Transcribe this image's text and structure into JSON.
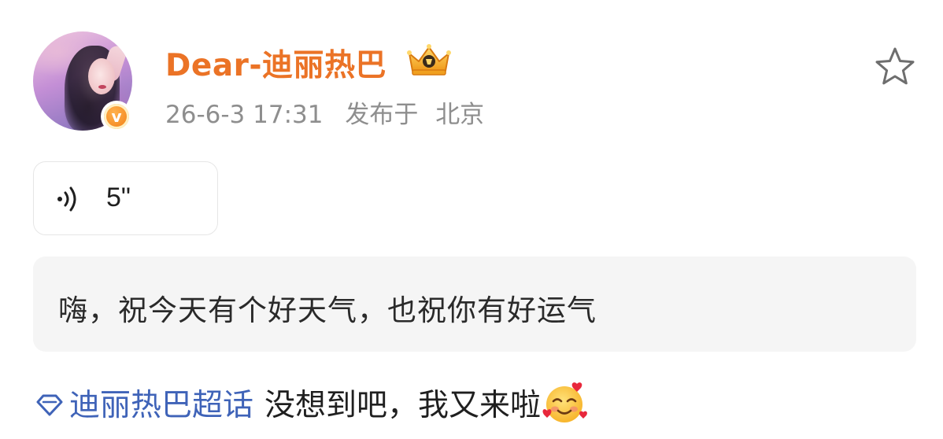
{
  "user": {
    "name": "Dear-迪丽热巴",
    "avatar_icon": "avatar-photo",
    "verified_icon": "verified-v-badge",
    "verified_letter": "v",
    "rank_icon": "crown-icon"
  },
  "post_meta": {
    "timestamp": "26-6-3 17:31",
    "location_label": "发布于",
    "location": "北京"
  },
  "actions": {
    "favorite_icon": "star-icon"
  },
  "voice": {
    "icon": "voice-wave-icon",
    "duration": "5\""
  },
  "quote": {
    "text": "嗨，祝今天有个好天气，也祝你有好运气"
  },
  "post": {
    "topic_icon": "diamond-topic-icon",
    "topic": "迪丽热巴超话",
    "text": "没想到吧，我又来啦",
    "emoji_icon": "smiling-face-with-hearts-icon"
  },
  "colors": {
    "name_orange": "#eb7326",
    "topic_blue": "#3f63b8",
    "meta_gray": "#8e8e8e",
    "quote_bg": "#f5f5f5"
  }
}
